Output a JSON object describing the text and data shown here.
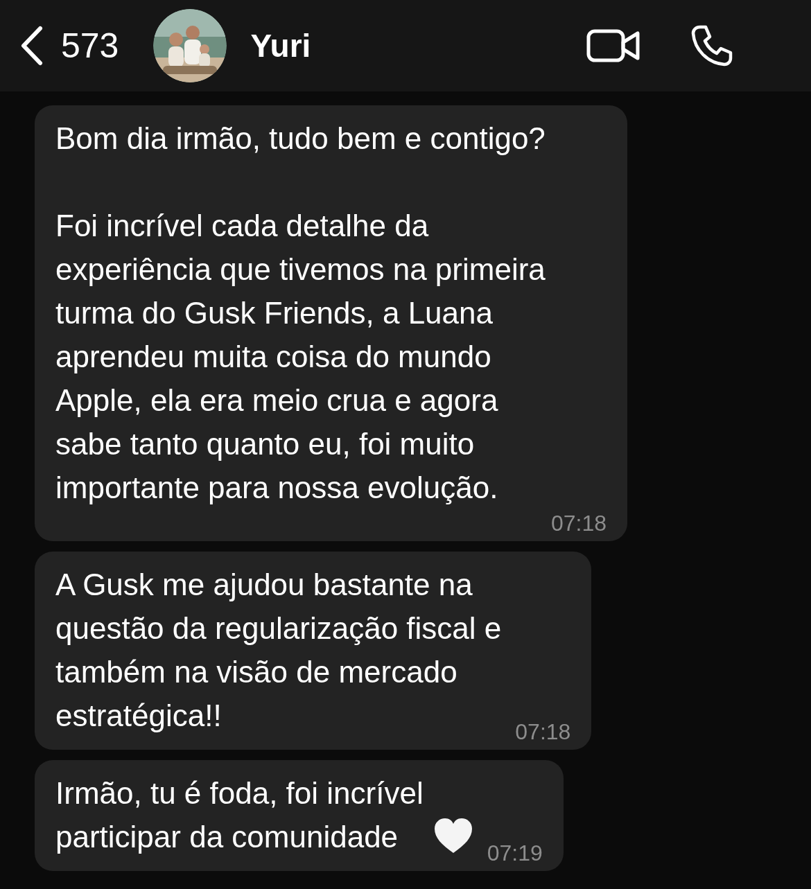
{
  "header": {
    "back_count": "573",
    "contact_name": "Yuri"
  },
  "messages": [
    {
      "text": "Bom dia irmão, tudo bem e contigo?\n\nFoi incrível cada detalhe da\nexperiência que tivemos na primeira\nturma do Gusk Friends, a Luana\naprendeu muita coisa do mundo\nApple, ela era meio crua e agora\nsabe tanto quanto eu, foi muito\nimportante para nossa evolução.",
      "time": "07:18",
      "has_emoji": false
    },
    {
      "text": "A Gusk me ajudou bastante na\nquestão da regularização fiscal e\ntambém na visão de mercado\nestratégica!!",
      "time": "07:18",
      "has_emoji": false
    },
    {
      "text": "Irmão, tu é foda, foi incrível\nparticipar da comunidade",
      "time": "07:19",
      "has_emoji": true
    }
  ]
}
